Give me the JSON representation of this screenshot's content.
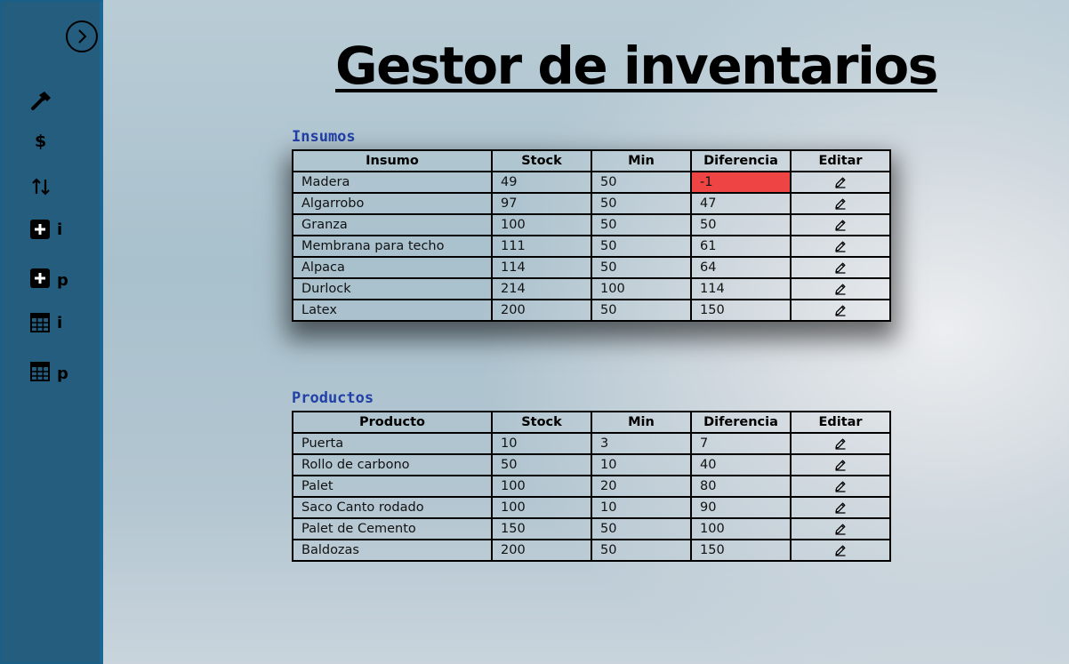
{
  "title": "Gestor de inventarios",
  "sidebar": {
    "letters": {
      "i": "i",
      "p": "p"
    },
    "dollar": "$"
  },
  "insumos": {
    "label": "Insumos",
    "headers": [
      "Insumo",
      "Stock",
      "Min",
      "Diferencia",
      "Editar"
    ],
    "rows": [
      {
        "name": "Madera",
        "stock": "49",
        "min": "50",
        "diff": "-1",
        "negative": true
      },
      {
        "name": "Algarrobo",
        "stock": "97",
        "min": "50",
        "diff": "47"
      },
      {
        "name": "Granza",
        "stock": "100",
        "min": "50",
        "diff": "50"
      },
      {
        "name": "Membrana para techo",
        "stock": "111",
        "min": "50",
        "diff": "61"
      },
      {
        "name": "Alpaca",
        "stock": "114",
        "min": "50",
        "diff": "64"
      },
      {
        "name": "Durlock",
        "stock": "214",
        "min": "100",
        "diff": "114"
      },
      {
        "name": "Latex",
        "stock": "200",
        "min": "50",
        "diff": "150"
      }
    ]
  },
  "productos": {
    "label": "Productos",
    "headers": [
      "Producto",
      "Stock",
      "Min",
      "Diferencia",
      "Editar"
    ],
    "rows": [
      {
        "name": "Puerta",
        "stock": "10",
        "min": "3",
        "diff": "7"
      },
      {
        "name": "Rollo de carbono",
        "stock": "50",
        "min": "10",
        "diff": "40"
      },
      {
        "name": "Palet",
        "stock": "100",
        "min": "20",
        "diff": "80"
      },
      {
        "name": "Saco Canto rodado",
        "stock": "100",
        "min": "10",
        "diff": "90"
      },
      {
        "name": "Palet de Cemento",
        "stock": "150",
        "min": "50",
        "diff": "100"
      },
      {
        "name": "Baldozas",
        "stock": "200",
        "min": "50",
        "diff": "150"
      }
    ]
  },
  "colors": {
    "sidebar": "#245d7d",
    "negative": "#ee4444",
    "section_label": "#2240a8"
  },
  "icons": [
    "chevron-right-icon",
    "hammer-icon",
    "dollar-icon",
    "sort-arrows-icon",
    "plus-square-icon",
    "table-icon",
    "pencil-icon"
  ]
}
